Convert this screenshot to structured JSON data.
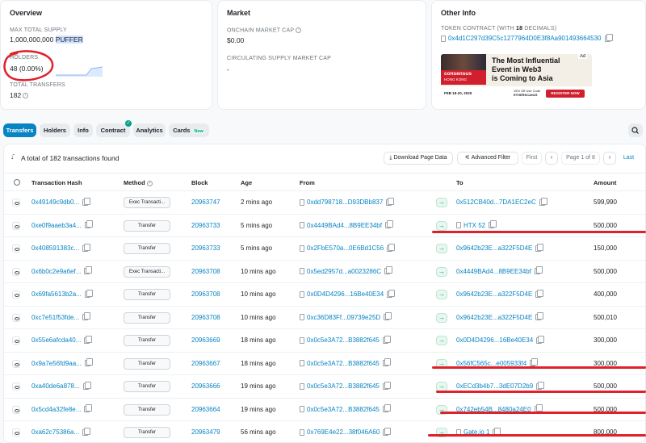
{
  "overview": {
    "title": "Overview",
    "max_supply_label": "MAX TOTAL SUPPLY",
    "max_supply_value": "1,000,000,000",
    "max_supply_token": "PUFFER",
    "holders_label": "HOLDERS",
    "holders_value": "48 (0.00%)",
    "transfers_label": "TOTAL TRANSFERS",
    "transfers_value": "182"
  },
  "market": {
    "title": "Market",
    "onchain_label": "ONCHAIN MARKET CAP",
    "onchain_value": "$0.00",
    "circulating_label": "CIRCULATING SUPPLY MARKET CAP",
    "circulating_value": "-"
  },
  "other_info": {
    "title": "Other Info",
    "contract_label_prefix": "TOKEN CONTRACT (WITH ",
    "contract_label_decimals": "18",
    "contract_label_suffix": " DECIMALS)",
    "contract_address": "0x4d1C297d39C5c1277964D0E3f8Aa901493664530"
  },
  "ad": {
    "badge": "Ad",
    "brand_line1": "consensus",
    "brand_line2": "HONG KONG",
    "headline_line1": "The Most Influential",
    "headline_line2": "Event in Web3",
    "headline_line3": "is Coming to Asia",
    "date": "FEB 18-20, 2025",
    "promo_line1": "15% Off Use Code",
    "promo_line2": "ETHERSCAN15",
    "cta": "REGISTER NOW"
  },
  "tabs": [
    {
      "label": "Transfers"
    },
    {
      "label": "Holders"
    },
    {
      "label": "Info"
    },
    {
      "label": "Contract"
    },
    {
      "label": "Analytics"
    },
    {
      "label": "Cards",
      "badge": "New"
    }
  ],
  "toolbar": {
    "summary": "A total of 182 transactions found",
    "download": "Download Page Data",
    "filter": "Advanced Filter",
    "first": "First",
    "page": "Page 1 of 8",
    "last": "Last"
  },
  "columns": {
    "hash": "Transaction Hash",
    "method": "Method",
    "block": "Block",
    "age": "Age",
    "from": "From",
    "to": "To",
    "amount": "Amount"
  },
  "rows": [
    {
      "hash": "0x49149c9db0...",
      "method": "Exec Transacti...",
      "block": "20963747",
      "age": "2 mins ago",
      "from": "0xdd798718...D93DBb837",
      "to": "0x512CB40d...7DA1EC2eC",
      "amount": "599,990"
    },
    {
      "hash": "0xe0f9aaeb3a4...",
      "method": "Transfer",
      "block": "20963733",
      "age": "5 mins ago",
      "from": "0x4449BAd4...8B9EE34bf",
      "to": "HTX 52",
      "amount": "500,000"
    },
    {
      "hash": "0x408591383c...",
      "method": "Transfer",
      "block": "20963733",
      "age": "5 mins ago",
      "from": "0x2FbE570a...0E6Bd1C56",
      "to": "0x9642b23E...a322F5D4E",
      "amount": "150,000"
    },
    {
      "hash": "0x6b0c2e9a6ef...",
      "method": "Exec Transacti...",
      "block": "20963708",
      "age": "10 mins ago",
      "from": "0x5ed2957d...a0023286C",
      "to": "0x4449BAd4...8B9EE34bf",
      "amount": "500,000"
    },
    {
      "hash": "0x69fa5613b2a...",
      "method": "Transfer",
      "block": "20963708",
      "age": "10 mins ago",
      "from": "0x0D4D4296...16Be40E34",
      "to": "0x9642b23E...a322F5D4E",
      "amount": "400,000"
    },
    {
      "hash": "0xc7e51f53fde...",
      "method": "Transfer",
      "block": "20963708",
      "age": "10 mins ago",
      "from": "0xc36D83Ff...09739e25D",
      "to": "0x9642b23E...a322F5D4E",
      "amount": "500,010"
    },
    {
      "hash": "0x55e6afcda40...",
      "method": "Transfer",
      "block": "20963669",
      "age": "18 mins ago",
      "from": "0x0c5e3A72...B3882f645",
      "to": "0x0D4D4296...16Be40E34",
      "amount": "300,000"
    },
    {
      "hash": "0x9a7e56fd9aa...",
      "method": "Transfer",
      "block": "20963667",
      "age": "18 mins ago",
      "from": "0x0c5e3A72...B3882f645",
      "to": "0x56fC565c...e005933f4",
      "amount": "300,000"
    },
    {
      "hash": "0xa40de6a878...",
      "method": "Transfer",
      "block": "20963666",
      "age": "19 mins ago",
      "from": "0x0c5e3A72...B3882f645",
      "to": "0xECd3b4b7...3dE07D2b9",
      "amount": "500,000"
    },
    {
      "hash": "0x5cd4a32fe8e...",
      "method": "Transfer",
      "block": "20963664",
      "age": "19 mins ago",
      "from": "0x0c5e3A72...B3882f645",
      "to": "0x742eb54B...8480a24E0",
      "amount": "500,000"
    },
    {
      "hash": "0xa62c75386a...",
      "method": "Transfer",
      "block": "20963479",
      "age": "56 mins ago",
      "from": "0x769E4e22...38f046A60",
      "to": "Gate.io 1",
      "amount": "800,000"
    }
  ],
  "colors": {
    "accent": "#0784c3",
    "annotation_red": "#e0202a",
    "arrow_green": "#00a186"
  }
}
